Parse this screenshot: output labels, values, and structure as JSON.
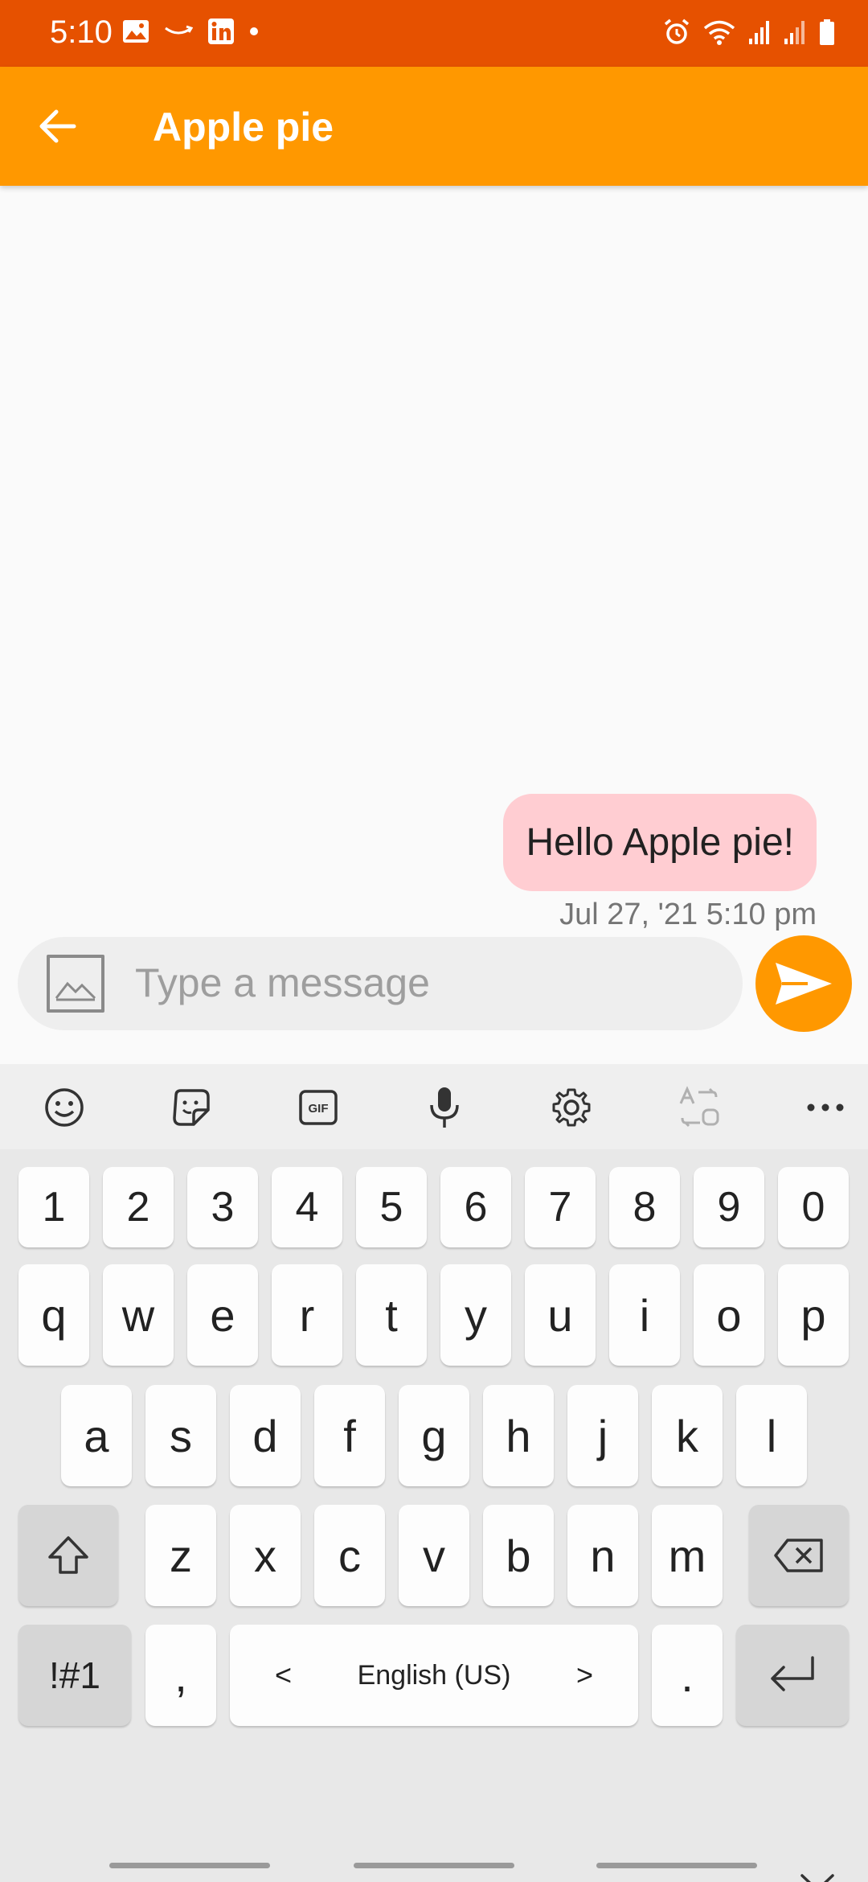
{
  "status": {
    "time": "5:10",
    "left_icons": [
      "gallery-icon",
      "amazon-icon",
      "linkedin-icon",
      "dot-icon"
    ],
    "right_icons": [
      "alarm-icon",
      "wifi-icon",
      "signal-icon",
      "signal-icon",
      "battery-icon"
    ]
  },
  "app_bar": {
    "title": "Apple pie",
    "back_icon": "back-arrow-icon"
  },
  "chat": {
    "messages": [
      {
        "text": "Hello Apple pie!",
        "time": "Jul 27, '21 5:10 pm"
      }
    ]
  },
  "composer": {
    "placeholder": "Type a message",
    "image_icon": "image-icon",
    "send_icon": "send-icon"
  },
  "keyboard": {
    "toolbar": [
      "emoji-icon",
      "sticker-icon",
      "gif-icon",
      "mic-icon",
      "settings-icon",
      "translate-icon",
      "more-icon"
    ],
    "gif_label": "GIF",
    "numbers": [
      "1",
      "2",
      "3",
      "4",
      "5",
      "6",
      "7",
      "8",
      "9",
      "0"
    ],
    "row1": [
      "q",
      "w",
      "e",
      "r",
      "t",
      "y",
      "u",
      "i",
      "o",
      "p"
    ],
    "row2": [
      "a",
      "s",
      "d",
      "f",
      "g",
      "h",
      "j",
      "k",
      "l"
    ],
    "row3": [
      "z",
      "x",
      "c",
      "v",
      "b",
      "n",
      "m"
    ],
    "symbols_label": "!#1",
    "comma": ",",
    "period": ".",
    "space_label": "English (US)",
    "space_left": "<",
    "space_right": ">"
  },
  "colors": {
    "status_bar": "#e65100",
    "app_bar": "#ff9800",
    "bubble": "#ffcdd2",
    "send": "#ff9800"
  }
}
